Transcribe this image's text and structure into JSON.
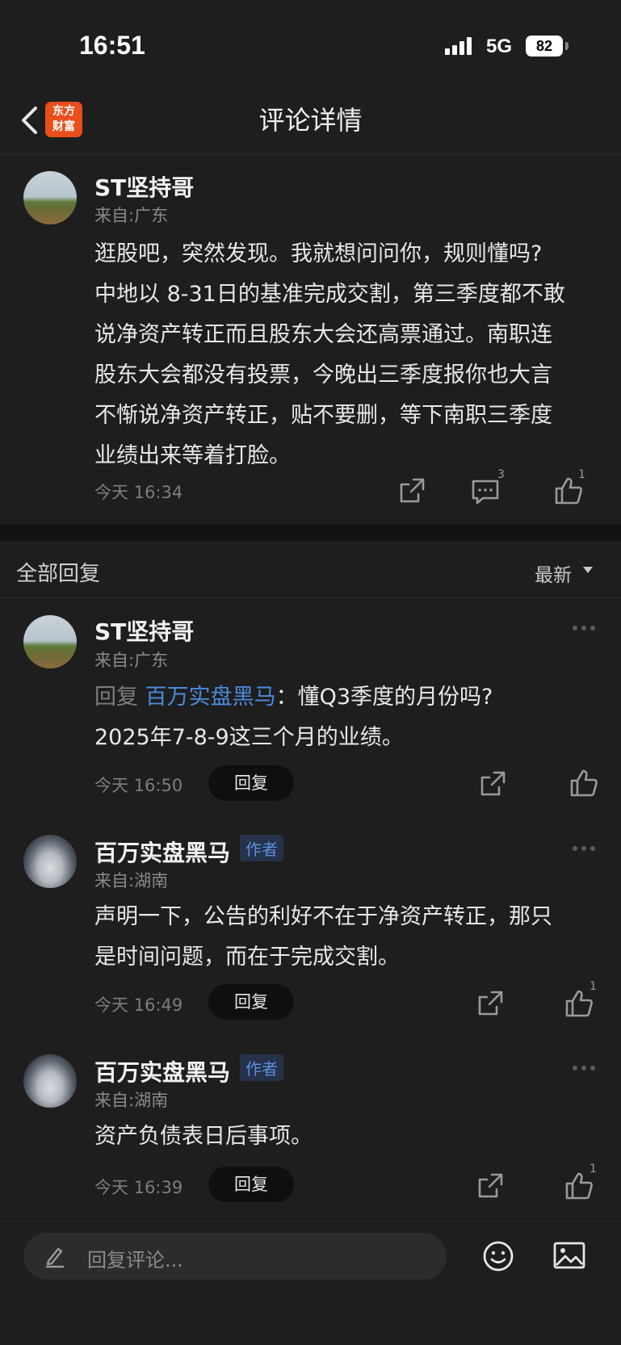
{
  "status_bar": {
    "time": "16:51",
    "network": "5G",
    "battery": "82"
  },
  "nav": {
    "logo_line1": "东方",
    "logo_line2": "财富",
    "title": "评论详情"
  },
  "main_post": {
    "username": "ST坚持哥",
    "location": "来自:广东",
    "lines": [
      "逛股吧，突然发现。我就想问问你，规则懂吗?",
      "中地以 8-31日的基准完成交割，第三季度都不敢",
      "说净资产转正而且股东大会还高票通过。南职连",
      "股东大会都没有投票，今晚出三季度报你也大言",
      "不惭说净资产转正，贴不要删，等下南职三季度",
      "业绩出来等着打脸。"
    ],
    "time": "今天 16:34",
    "comment_count": "3",
    "like_count": "1"
  },
  "replies_section": {
    "title": "全部回复",
    "sort_label": "最新"
  },
  "replies": [
    {
      "username": "ST坚持哥",
      "location": "来自:广东",
      "reply_prefix": "回复",
      "reply_target": "百万实盘黑马",
      "line1": "：懂Q3季度的月份吗?",
      "line2": "2025年7-8-9这三个月的业绩。",
      "time": "今天 16:50",
      "reply_label": "回复",
      "like_count": ""
    },
    {
      "username": "百万实盘黑马",
      "badge": "作者",
      "location": "来自:湖南",
      "line1": "声明一下，公告的利好不在于净资产转正，那只",
      "line2": "是时间问题，而在于完成交割。",
      "time": "今天 16:49",
      "reply_label": "回复",
      "like_count": "1"
    },
    {
      "username": "百万实盘黑马",
      "badge": "作者",
      "location": "来自:湖南",
      "line1": "资产负债表日后事项。",
      "time": "今天 16:39",
      "reply_label": "回复",
      "like_count": "1"
    }
  ],
  "bottom_bar": {
    "placeholder": "回复评论..."
  },
  "icons": {
    "back": "chevron-left-icon",
    "share": "share-icon",
    "comment": "comment-icon",
    "like": "thumbs-up-icon",
    "more": "more-dots-icon",
    "edit": "pencil-icon",
    "emoji": "emoji-icon",
    "image": "image-icon"
  }
}
